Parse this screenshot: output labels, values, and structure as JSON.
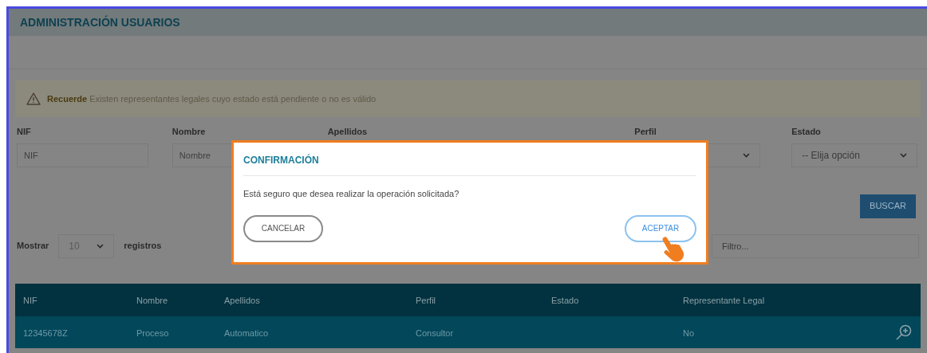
{
  "page": {
    "title": "ADMINISTRACIÓN USUARIOS"
  },
  "alert": {
    "label": "Recuerde",
    "message": "Existen representantes legales cuyo estado está pendiente o no es válido"
  },
  "filters": [
    {
      "label": "NIF",
      "kind": "input",
      "placeholder": "NIF"
    },
    {
      "label": "Nombre",
      "kind": "input",
      "placeholder": "Nombre"
    },
    {
      "label": "Apellidos",
      "kind": "covered"
    },
    {
      "label": "Perfil",
      "kind": "select"
    },
    {
      "label": "Estado",
      "kind": "select",
      "value": "-- Elija opción"
    }
  ],
  "search_button": "BUSCAR",
  "page_length": {
    "prefix": "Mostrar",
    "value": "10",
    "suffix": "registros"
  },
  "filter_field": {
    "placeholder": "Filtro..."
  },
  "table": {
    "columns": [
      "NIF",
      "Nombre",
      "Apellidos",
      "Perfil",
      "Estado",
      "Representante Legal"
    ],
    "rows": [
      {
        "cells": [
          "12345678Z",
          "Proceso",
          "Automatico",
          "Consultor",
          null,
          "No"
        ]
      }
    ]
  },
  "modal": {
    "title": "CONFIRMACIÓN",
    "message": "Está seguro que desea realizar la operación solicitada?",
    "buttons": [
      {
        "label": "CANCELAR",
        "kind": "secondary"
      },
      {
        "label": "ACEPTAR",
        "kind": "primary"
      }
    ]
  }
}
